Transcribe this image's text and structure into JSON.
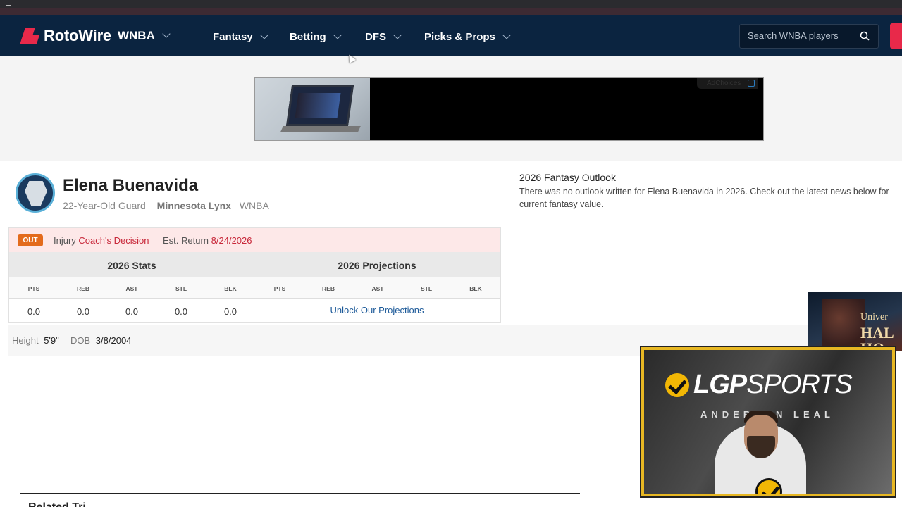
{
  "nav": {
    "brand": "RotoWire",
    "league": "WNBA",
    "items": [
      {
        "label": "Fantasy"
      },
      {
        "label": "Betting"
      },
      {
        "label": "DFS"
      },
      {
        "label": "Picks & Props"
      }
    ],
    "search_placeholder": "Search WNBA players"
  },
  "ad": {
    "choices_label": "AdChoices"
  },
  "player": {
    "name": "Elena Buenavida",
    "descriptor": "22-Year-Old Guard",
    "team": "Minnesota Lynx",
    "league": "WNBA"
  },
  "outlook": {
    "title": "2026 Fantasy Outlook",
    "text": "There was no outlook written for Elena Buenavida in 2026. Check out the latest news below for current fantasy value."
  },
  "injury": {
    "badge": "OUT",
    "label": "Injury",
    "value": "Coach's Decision",
    "est_label": "Est. Return",
    "est_value": "8/24/2026"
  },
  "stats": {
    "stats_title": "2026 Stats",
    "proj_title": "2026 Projections",
    "columns": [
      "PTS",
      "REB",
      "AST",
      "STL",
      "BLK"
    ],
    "values": [
      "0.0",
      "0.0",
      "0.0",
      "0.0",
      "0.0"
    ],
    "unlock_label": "Unlock Our Projections"
  },
  "bio": {
    "height_label": "Height",
    "height_value": "5'9\"",
    "dob_label": "DOB",
    "dob_value": "3/8/2004"
  },
  "next_section": {
    "title": "Related Tri"
  },
  "overlay": {
    "side_video_text": [
      "Univer",
      "HAL",
      "HO"
    ],
    "brand_word": "LGP",
    "brand_word2": "SPORTS",
    "brand_sub": "ANDERSON LEAL"
  },
  "colors": {
    "nav_bg": "#0b2440",
    "brand_red": "#e8294a",
    "out_badge": "#e36b1c",
    "injury_value": "#c8283a",
    "link": "#1d5a99",
    "overlay_gold": "#e7b723"
  }
}
